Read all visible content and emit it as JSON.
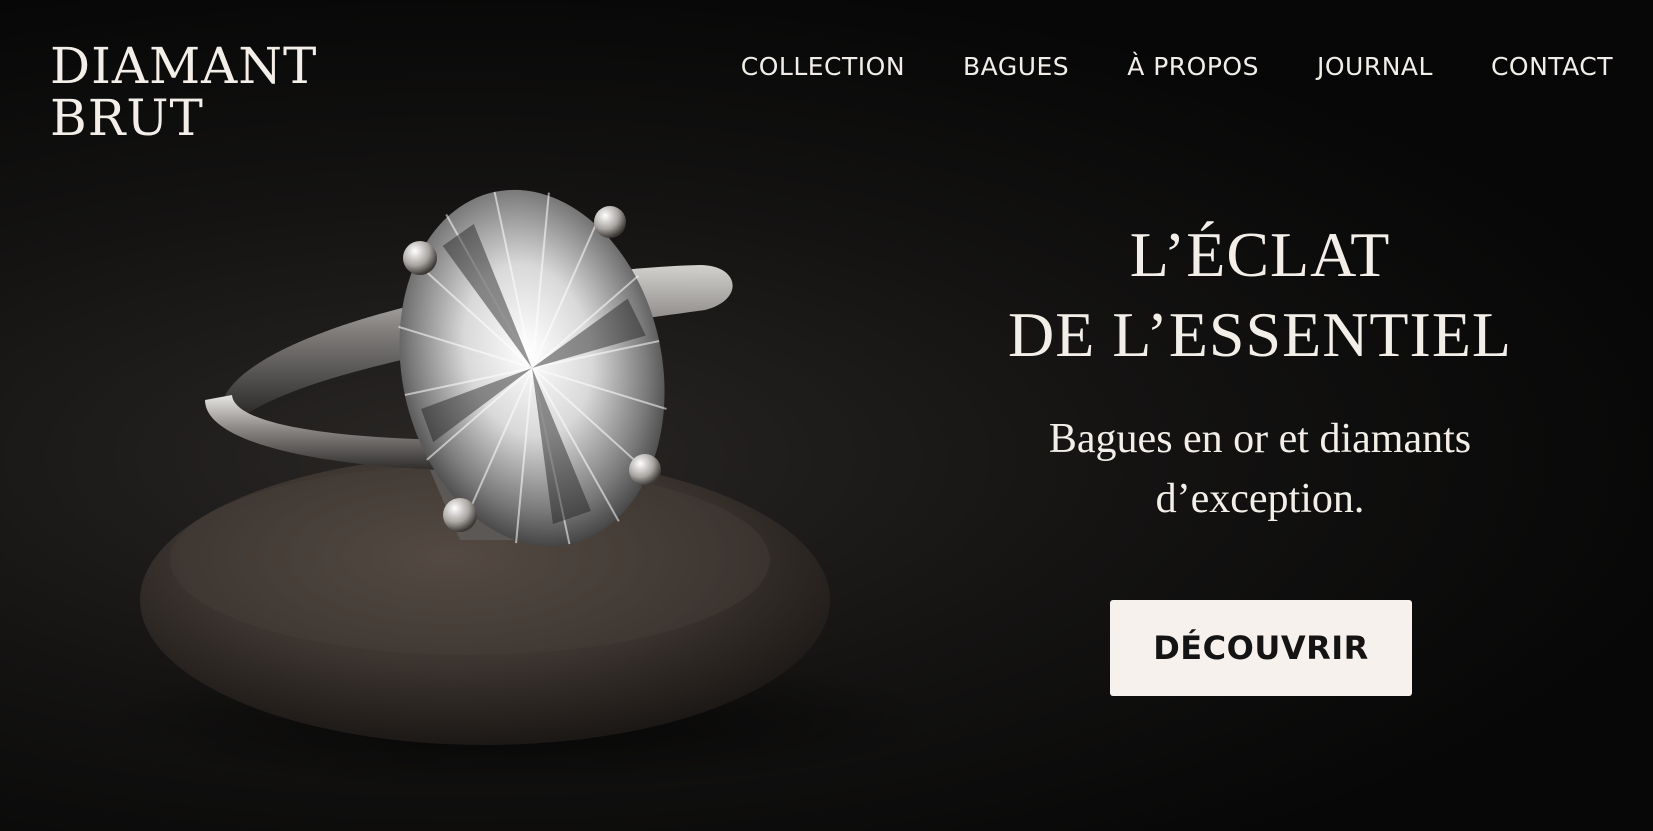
{
  "brand": {
    "line1": "DIAMANT",
    "line2": "BRUT"
  },
  "nav": {
    "items": [
      {
        "label": "COLLECTION"
      },
      {
        "label": "BAGUES"
      },
      {
        "label": "À PROPOS"
      },
      {
        "label": "JOURNAL"
      },
      {
        "label": "CONTACT"
      }
    ]
  },
  "hero": {
    "headline_line1": "L’ÉCLAT",
    "headline_line2": "DE L’ESSENTIEL",
    "subheadline_line1": "Bagues en or et diamants",
    "subheadline_line2": "d’exception.",
    "cta_label": "DÉCOUVRIR",
    "image_subject": "oval diamond solitaire ring resting on a dark stone"
  },
  "colors": {
    "background": "#050505",
    "text": "#f3efe8",
    "button_bg": "#f6f1ec",
    "button_text": "#141414"
  }
}
